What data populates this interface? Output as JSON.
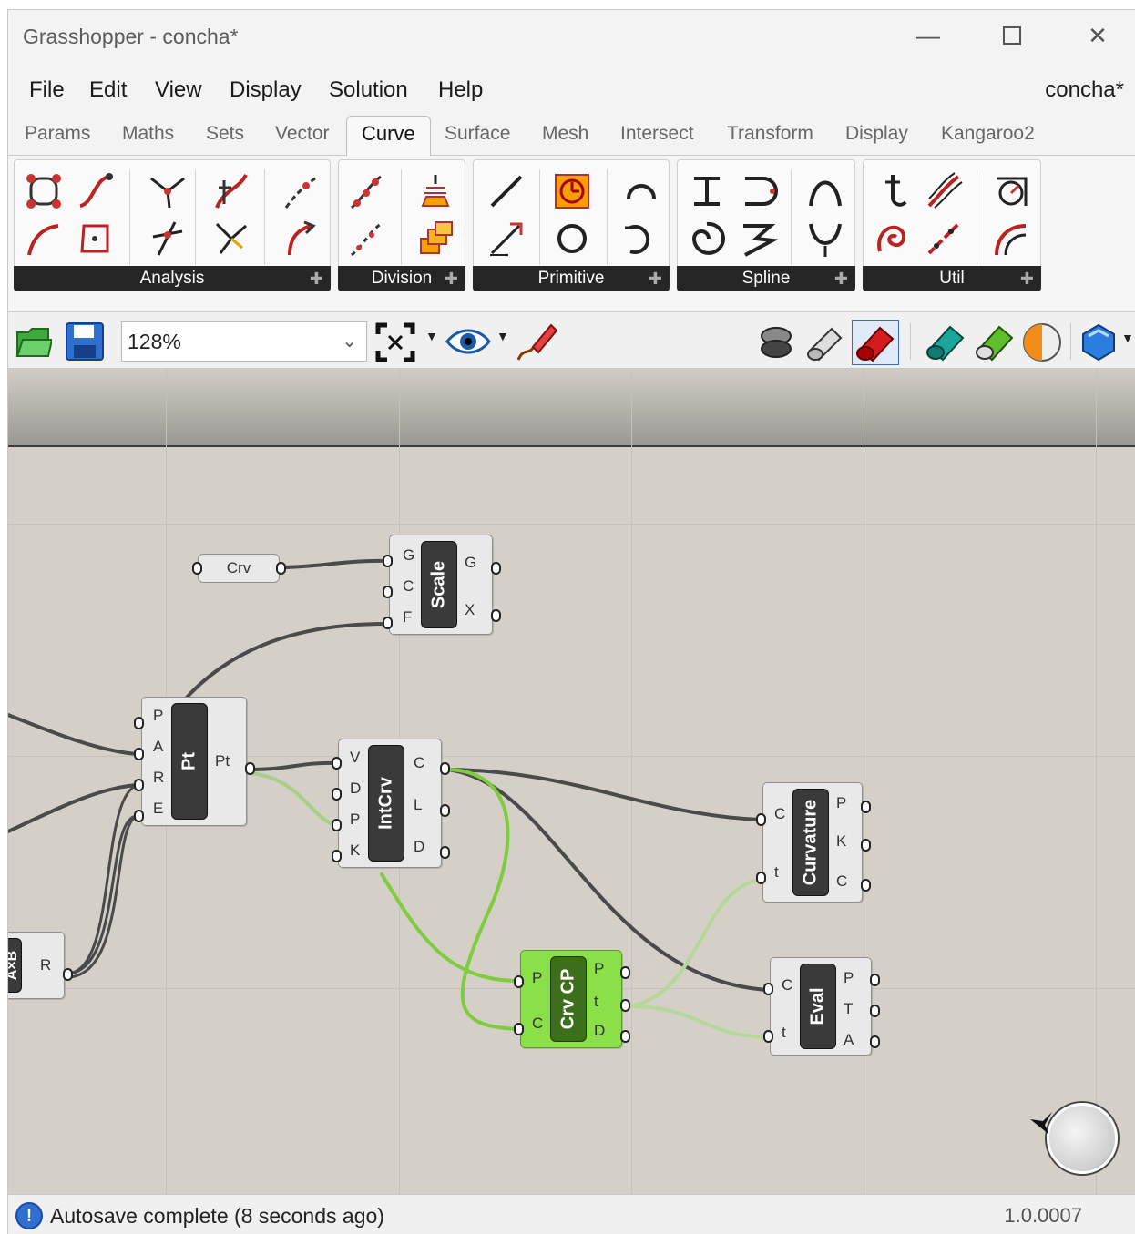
{
  "window": {
    "title": "Grasshopper - concha*",
    "doc_name": "concha*"
  },
  "menu": [
    "File",
    "Edit",
    "View",
    "Display",
    "Solution",
    "Help"
  ],
  "tabs": [
    "Params",
    "Maths",
    "Sets",
    "Vector",
    "Curve",
    "Surface",
    "Mesh",
    "Intersect",
    "Transform",
    "Display",
    "Kangaroo2"
  ],
  "active_tab": "Curve",
  "ribbon_panels": [
    "Analysis",
    "Division",
    "Primitive",
    "Spline",
    "Util"
  ],
  "toolbar": {
    "zoom": "128%"
  },
  "canvas": {
    "crv_param": "Crv",
    "scale": {
      "name": "Scale",
      "inputs": [
        "G",
        "C",
        "F"
      ],
      "outputs": [
        "G",
        "X"
      ]
    },
    "pt": {
      "name": "Pt",
      "inputs": [
        "P",
        "A",
        "R",
        "E"
      ],
      "outputs": [
        "Pt"
      ]
    },
    "intcrv": {
      "name": "IntCrv",
      "inputs": [
        "V",
        "D",
        "P",
        "K"
      ],
      "outputs": [
        "C",
        "L",
        "D"
      ]
    },
    "curvature": {
      "name": "Curvature",
      "inputs": [
        "C",
        "t"
      ],
      "outputs": [
        "P",
        "K",
        "C"
      ]
    },
    "crvcp": {
      "name": "Crv CP",
      "inputs": [
        "P",
        "C"
      ],
      "outputs": [
        "P",
        "t",
        "D"
      ]
    },
    "eval": {
      "name": "Eval",
      "inputs": [
        "C",
        "t"
      ],
      "outputs": [
        "P",
        "T",
        "A"
      ]
    },
    "axb": {
      "name": "A×B",
      "outputs": [
        "R"
      ]
    }
  },
  "status": {
    "message": "Autosave complete (8 seconds ago)",
    "version": "1.0.0007"
  },
  "colors": {
    "wire_dark": "#4a4a4a",
    "wire_green": "#7fcc3f",
    "canvas": "#d4d0c8",
    "selected": "#8be04a"
  }
}
